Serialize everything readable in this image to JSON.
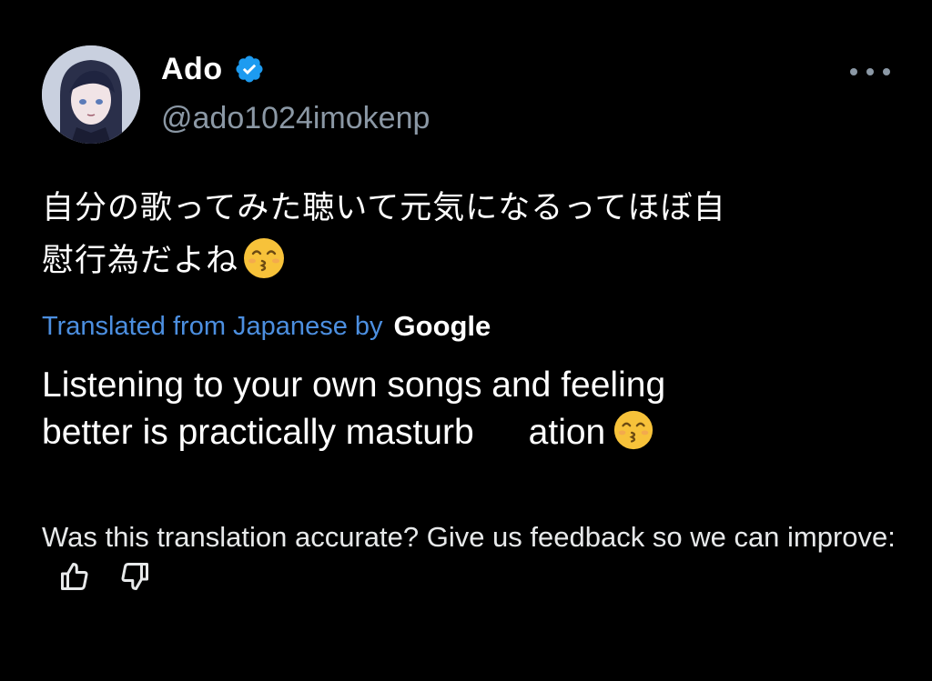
{
  "post": {
    "author": {
      "display_name": "Ado",
      "handle": "@ado1024imokenp",
      "verified": true,
      "avatar_icon": "anime-avatar"
    },
    "more_icon": "more-horizontal-icon",
    "original_text_line1": "自分の歌ってみた聴いて元気になるってほぼ自",
    "original_text_line2": "慰行為だよね",
    "emoji": "kissing-face-with-smiling-eyes",
    "translation": {
      "label": "Translated from Japanese by",
      "provider": "Google",
      "text_line1": "Listening to your own songs and feeling",
      "text_line2": "better is practically masturb",
      "text_line2_tail": "ation"
    },
    "feedback": {
      "prompt": "Was this translation accurate? Give us feedback so we can improve:",
      "thumbs_up_icon": "thumbs-up-icon",
      "thumbs_down_icon": "thumbs-down-icon"
    }
  },
  "colors": {
    "background": "#000000",
    "text_primary": "#ffffff",
    "text_secondary": "#8b98a5",
    "link_blue": "#4c8fe0",
    "verified_blue": "#1d9bf0"
  }
}
